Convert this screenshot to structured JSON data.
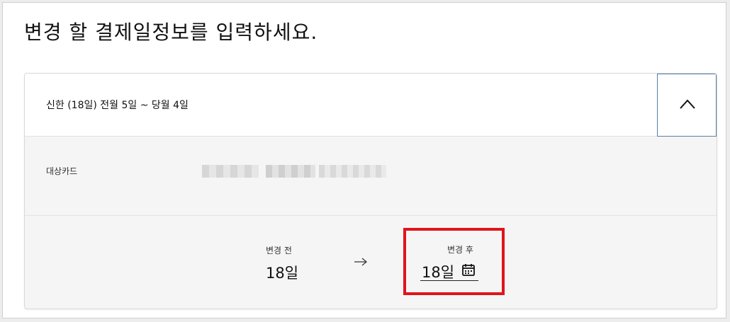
{
  "page": {
    "title": "변경 할 결제일정보를 입력하세요."
  },
  "card": {
    "header_title": "신한 (18일) 전월 5일 ~ 당월 4일",
    "collapse_icon": "chevron-up-icon"
  },
  "info": {
    "target_card_label": "대상카드",
    "target_card_value_masked": true
  },
  "change": {
    "before_label": "변경 전",
    "before_value": "18일",
    "arrow_icon": "arrow-right-icon",
    "after_label": "변경 후",
    "after_value": "18일",
    "calendar_icon": "calendar-icon"
  },
  "colors": {
    "highlight_border": "#e0141b",
    "collapse_button_border": "#5b7fa6",
    "card_background": "#f5f5f5"
  }
}
